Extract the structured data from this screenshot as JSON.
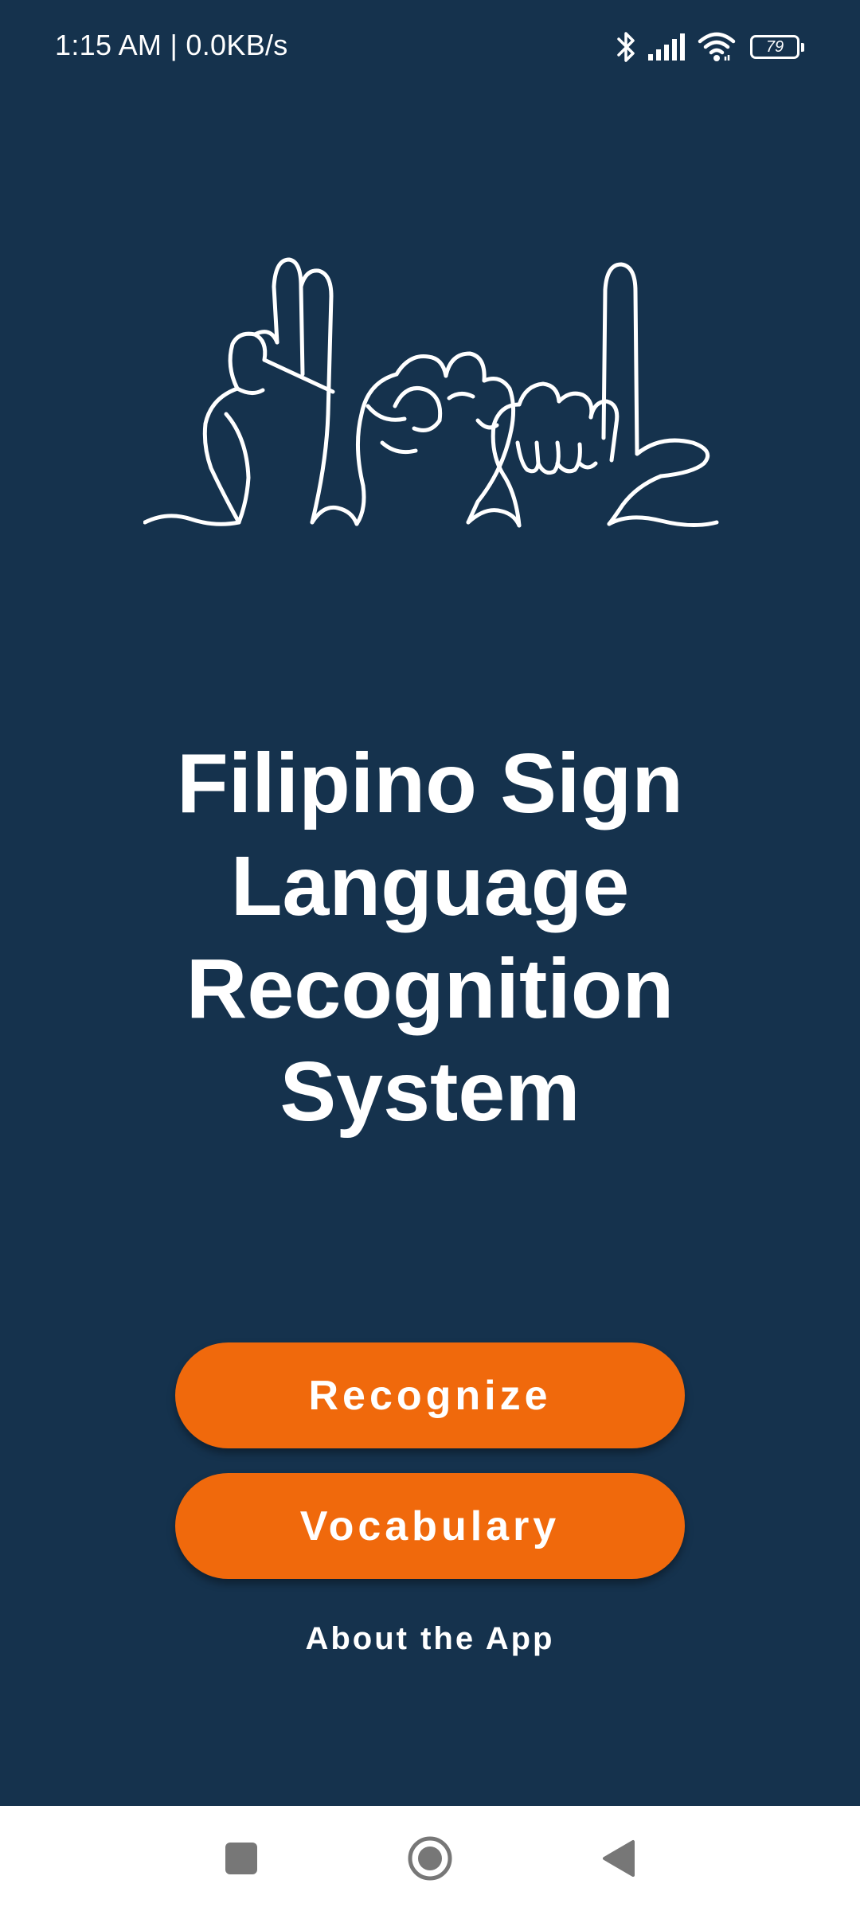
{
  "status_bar": {
    "time_speed": "1:15 AM | 0.0KB/s",
    "battery_level": "79",
    "icons": [
      "bluetooth-icon",
      "signal-icon",
      "wifi-icon",
      "battery-icon"
    ]
  },
  "main": {
    "logo": "fsl-hands-logo",
    "title": "Filipino Sign Language Recognition System",
    "recognize_label": "Recognize",
    "vocabulary_label": "Vocabulary",
    "about_label": "About the App"
  },
  "nav_bar": {
    "icons": [
      "recents-square-icon",
      "home-circle-icon",
      "back-triangle-icon"
    ]
  },
  "colors": {
    "background": "#15324d",
    "accent": "#f0690c",
    "text": "#ffffff",
    "nav_background": "#ffffff",
    "nav_icon": "#777777"
  }
}
